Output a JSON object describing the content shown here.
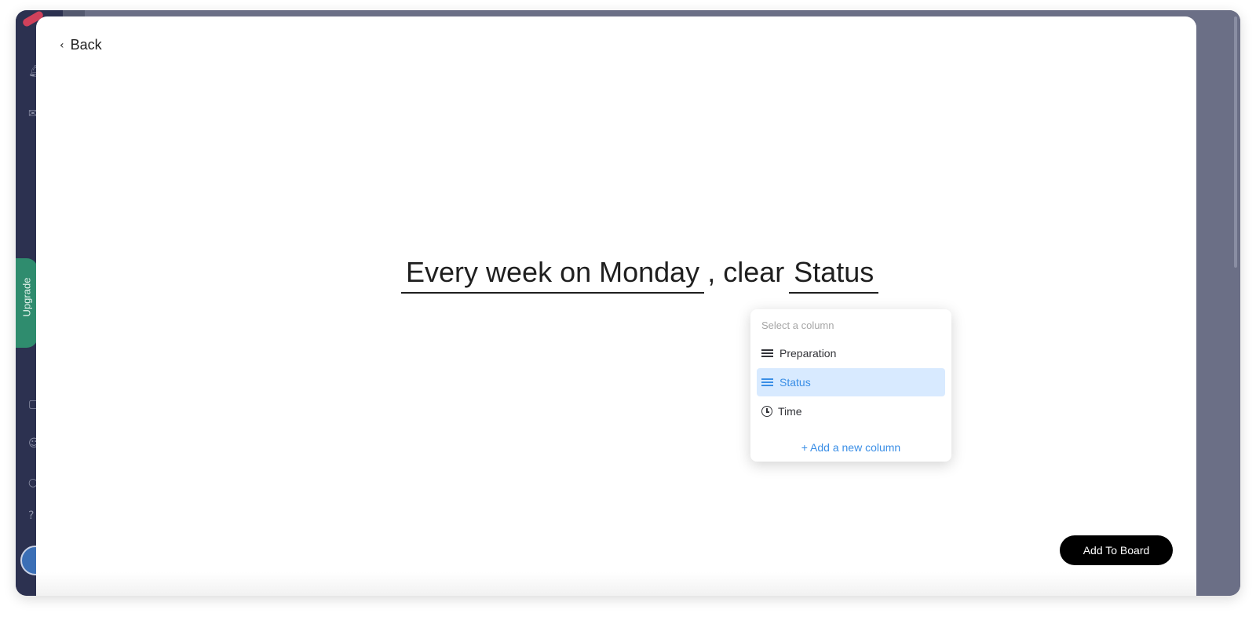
{
  "modal": {
    "back_label": "Back",
    "sentence": {
      "trigger": "Every week on Monday",
      "separator": ", clear",
      "column": "Status"
    },
    "dropdown": {
      "title": "Select a column",
      "items": [
        {
          "label": "Preparation",
          "icon": "lines-icon",
          "selected": false
        },
        {
          "label": "Status",
          "icon": "lines-icon",
          "selected": true
        },
        {
          "label": "Time",
          "icon": "clock-icon",
          "selected": false
        }
      ],
      "add_label": "+ Add a new column"
    },
    "add_to_board_label": "Add To Board"
  },
  "sidebar": {
    "upgrade_label": "Upgrade"
  },
  "colors": {
    "accent": "#3a8ee6",
    "selected_bg": "#d8eaff",
    "sidebar_bg": "#2c3150",
    "upgrade_green": "#2f8c6e"
  }
}
